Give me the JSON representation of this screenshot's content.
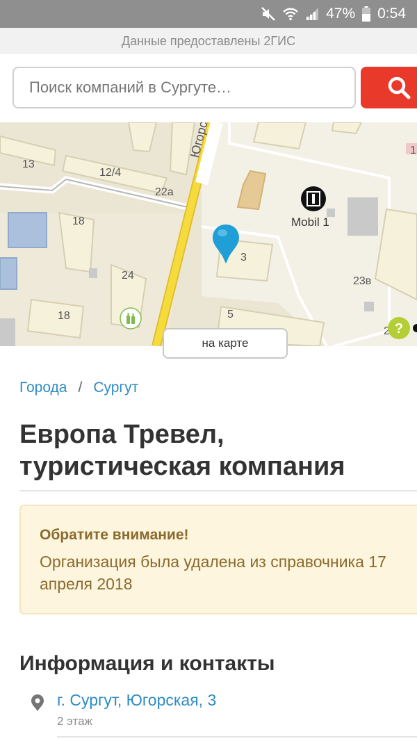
{
  "status_bar": {
    "battery": "47%",
    "time": "0:54"
  },
  "provider": "Данные предоставлены 2ГИС",
  "search": {
    "placeholder": "Поиск компаний в Сургуте…"
  },
  "map": {
    "street": "Югорск",
    "house_labels": [
      "13",
      "12/4",
      "22а",
      "18",
      "24",
      "18",
      "3",
      "5",
      "23в",
      "2",
      "1"
    ],
    "poi": "Mobil 1",
    "button": "на карте"
  },
  "breadcrumb": {
    "cities": "Города",
    "separator": "/",
    "city": "Сургут"
  },
  "company": {
    "title": "Европа Тревел, туристическая компания"
  },
  "notice": {
    "heading": "Обратите внимание!",
    "text": "Организация была удалена из справочника 17 апреля 2018"
  },
  "info": {
    "heading": "Информация и контакты",
    "address": "г. Сургут, Югорская, 3",
    "floor": "2 этаж"
  },
  "colors": {
    "accent_red": "#e8392b",
    "link_blue": "#2f8bc3",
    "notice_bg": "#fdf5dd",
    "road_yellow": "#f3d737"
  }
}
